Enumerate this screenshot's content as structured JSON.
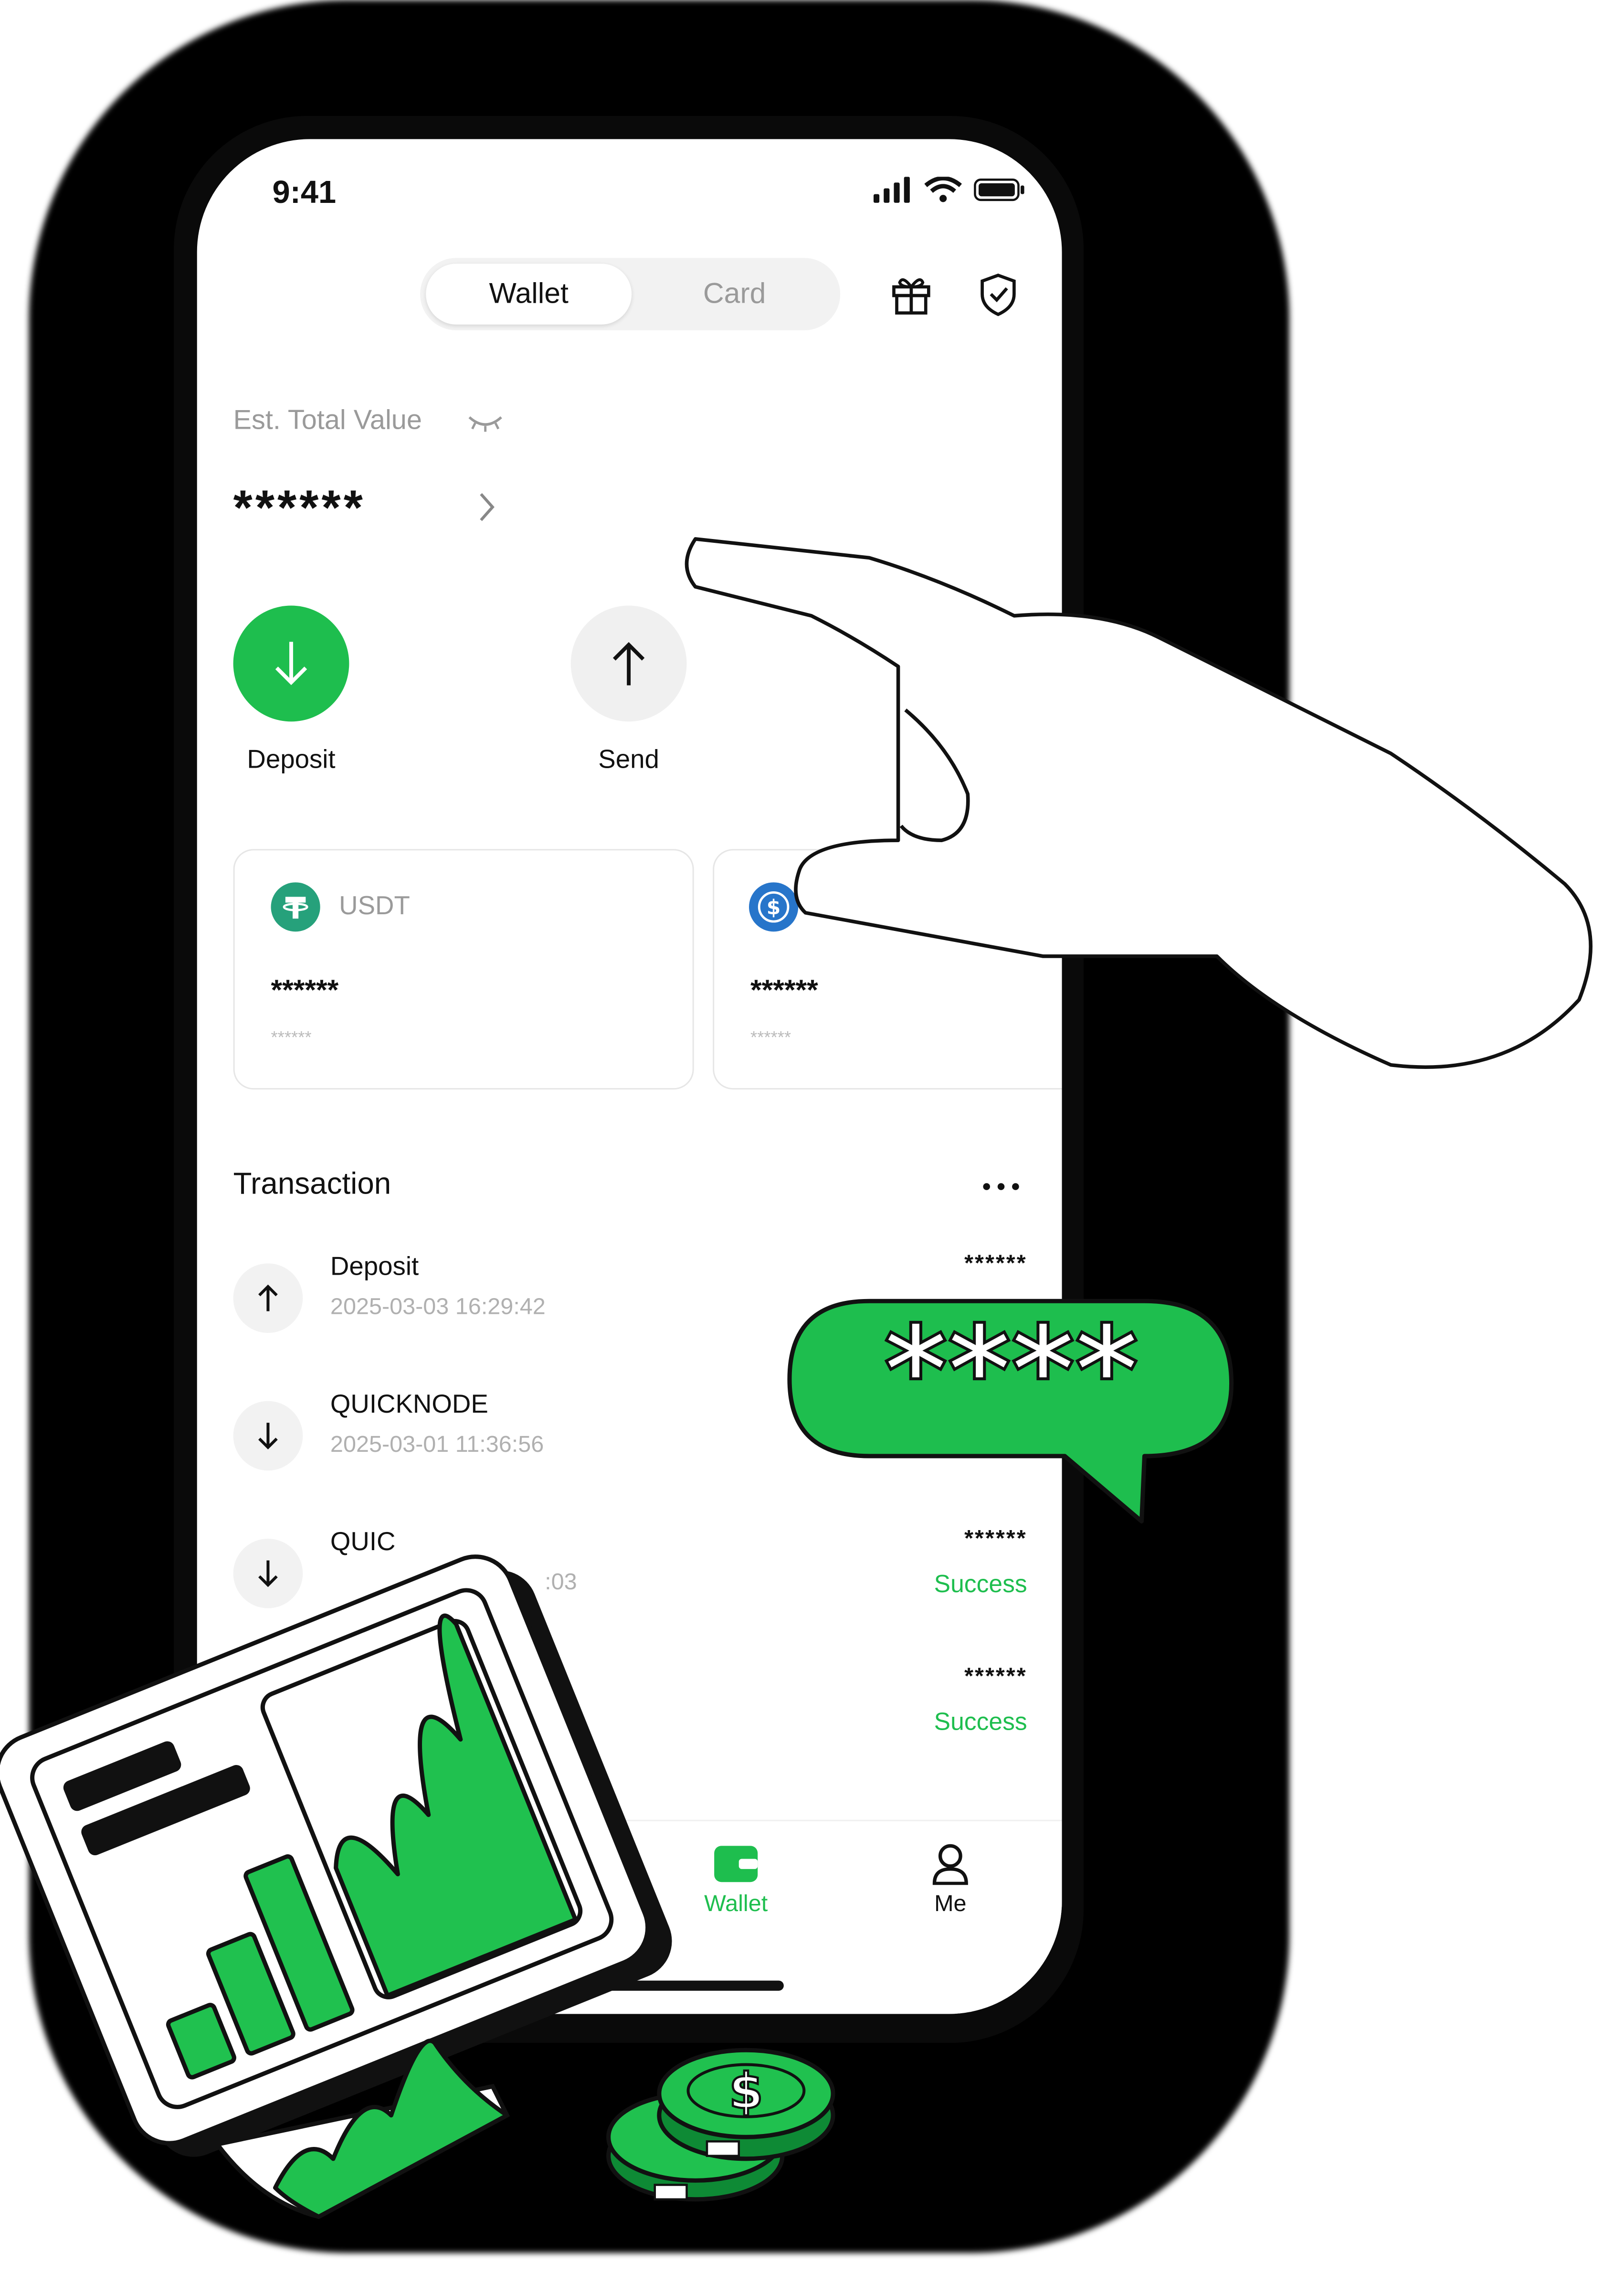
{
  "status_bar": {
    "time": "9:41"
  },
  "header": {
    "tabs": [
      {
        "label": "Wallet"
      },
      {
        "label": "Card"
      }
    ],
    "icons": [
      "gift-icon",
      "shield-check-icon"
    ]
  },
  "balance": {
    "label": "Est. Total Value",
    "value": "******"
  },
  "actions": [
    {
      "label": "Deposit",
      "icon": "arrow-down-icon"
    },
    {
      "label": "Send",
      "icon": "arrow-up-icon"
    }
  ],
  "assets": [
    {
      "symbol": "USDT",
      "amount": "******",
      "sub": "******",
      "icon": "tether-icon"
    },
    {
      "symbol": "",
      "amount": "******",
      "sub": "******",
      "icon": "usdc-icon"
    }
  ],
  "transactions": {
    "title": "Transaction",
    "items": [
      {
        "name": "Deposit",
        "date": "2025-03-03 16:29:42",
        "amount": "******",
        "status": "",
        "icon": "arrow-up-icon"
      },
      {
        "name": "QUICKNODE",
        "date": "2025-03-01 11:36:56",
        "amount": "",
        "status": "",
        "icon": "arrow-down-icon"
      },
      {
        "name": "QUIC",
        "date": ":03",
        "amount": "******",
        "status": "Success",
        "icon": "arrow-down-icon"
      },
      {
        "name": "",
        "date": "",
        "amount": "******",
        "status": "Success",
        "icon": ""
      }
    ]
  },
  "tab_bar": {
    "items": [
      {
        "label": "Wallet",
        "active": true
      },
      {
        "label": "Me",
        "active": false
      }
    ]
  },
  "overlay": {
    "bubble_text": "****"
  },
  "colors": {
    "accent": "#1ebe4e",
    "dark": "#0a0a0a",
    "illustration_green": "#20c14f"
  }
}
